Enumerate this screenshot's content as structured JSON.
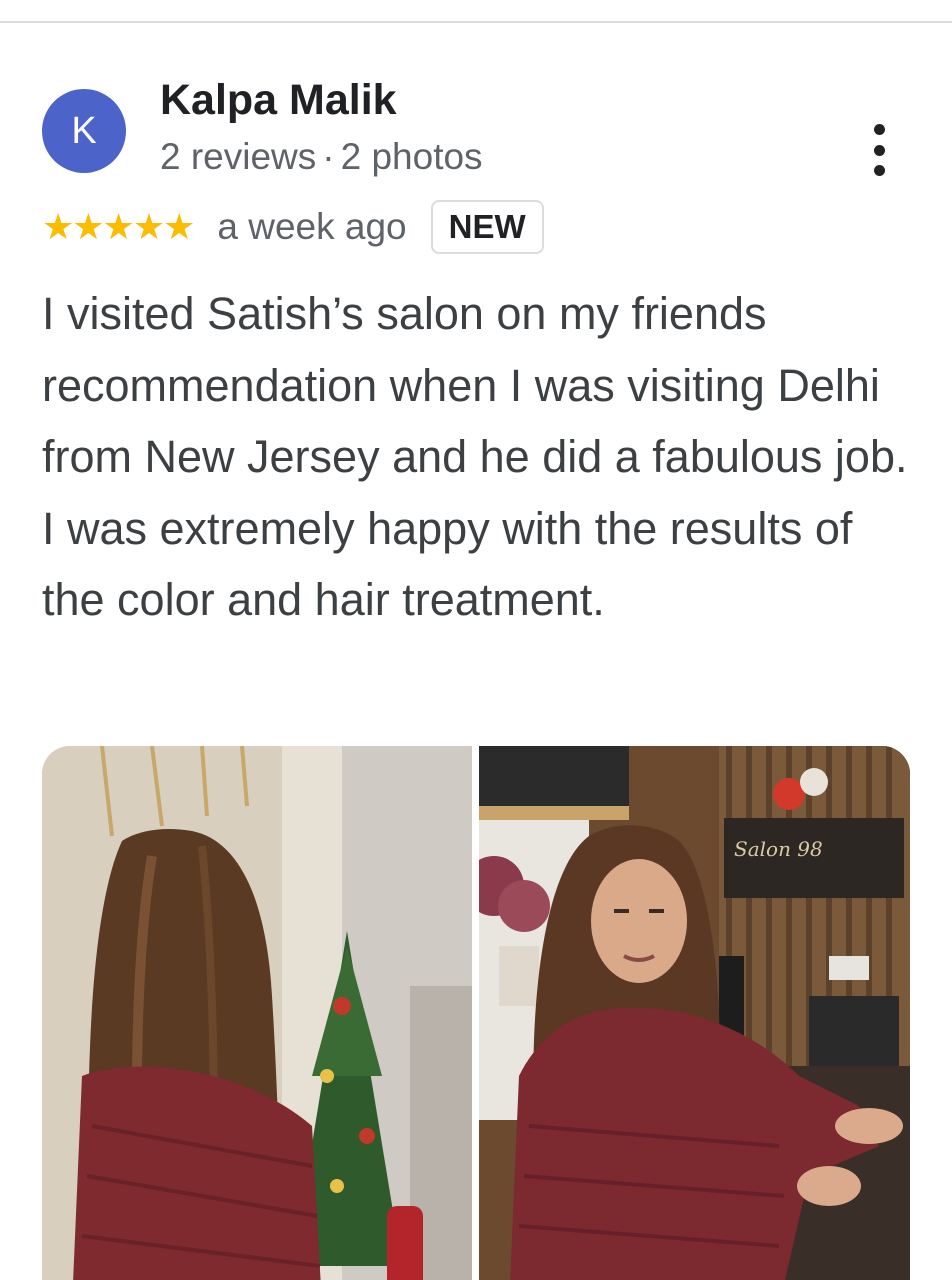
{
  "reviewer": {
    "avatar_letter": "K",
    "name": "Kalpa Malik",
    "reviews_count": "2 reviews",
    "separator": "·",
    "photos_count": "2 photos"
  },
  "review": {
    "stars": "★★★★★",
    "rating": 5,
    "time_ago": "a week ago",
    "badge": "NEW",
    "text": "I visited Satish’s salon on my friends recommendation when I was visiting Delhi from New Jersey and he did a fabulous job. I was extremely happy with the results of the color and hair treatment."
  },
  "photos": {
    "photo_2_sign": "Salon 98"
  },
  "colors": {
    "avatar": "#4c63c9",
    "stars": "#fbbc04",
    "text": "#3c4043",
    "meta": "#5f6368"
  },
  "icons": {
    "more": "more-vert-icon",
    "star": "star-icon"
  }
}
